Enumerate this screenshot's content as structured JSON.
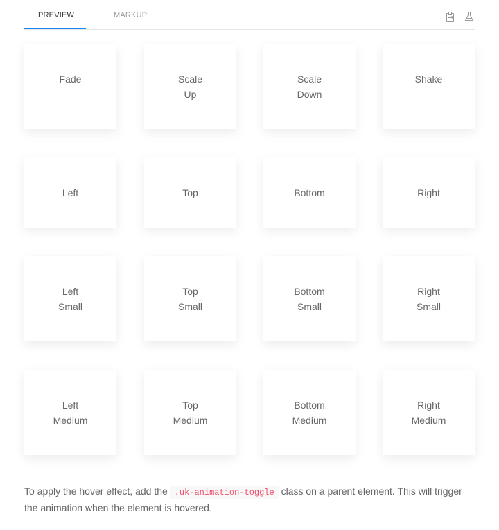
{
  "tabs": {
    "preview": "Preview",
    "markup": "Markup"
  },
  "toolbar": {
    "icons": [
      "copy-to-clipboard-icon",
      "flask-icon"
    ],
    "accent": "#1e87f0"
  },
  "cards": [
    [
      "Fade",
      ""
    ],
    [
      "Scale",
      "Up"
    ],
    [
      "Scale",
      "Down"
    ],
    [
      "Shake",
      ""
    ],
    [
      "Left",
      ""
    ],
    [
      "Top",
      ""
    ],
    [
      "Bottom",
      ""
    ],
    [
      "Right",
      ""
    ],
    [
      "Left",
      "Small"
    ],
    [
      "Top",
      "Small"
    ],
    [
      "Bottom",
      "Small"
    ],
    [
      "Right",
      "Small"
    ],
    [
      "Left",
      "Medium"
    ],
    [
      "Top",
      "Medium"
    ],
    [
      "Bottom",
      "Medium"
    ],
    [
      "Right",
      "Medium"
    ]
  ],
  "description": {
    "before": "To apply the hover effect, add the ",
    "code": ".uk-animation-toggle",
    "after": " class on a parent element. This will trigger the animation when the element is hovered."
  }
}
